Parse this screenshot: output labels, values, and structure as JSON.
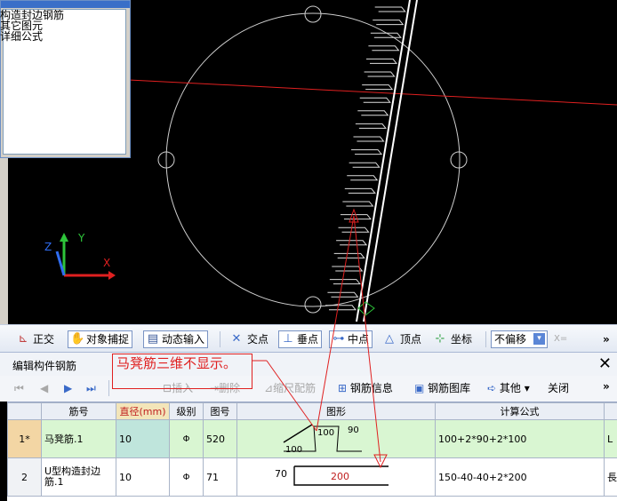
{
  "popup": {
    "lines": [
      "构造封边钢筋",
      "其它图元",
      "详细公式"
    ]
  },
  "snapbar": {
    "ortho": "正交",
    "object_snap": "对象捕捉",
    "dynamic_input": "动态输入",
    "intersection": "交点",
    "perpendicular": "垂点",
    "midpoint": "中点",
    "vertex": "顶点",
    "coordinate": "坐标",
    "offset_value": "不偏移",
    "x_label": "X=",
    "more": "»"
  },
  "panel": {
    "title": "编辑构件钢筋",
    "annotation": "马凳筋三维不显示。",
    "toolbar": {
      "insert": "插入",
      "delete": "删除",
      "scale_rebar": "缩尺配筋",
      "rebar_info": "钢筋信息",
      "rebar_library": "钢筋图库",
      "other": "其他",
      "close": "关闭",
      "more": "»"
    },
    "columns": [
      "筋号",
      "直径(mm)",
      "级别",
      "图号",
      "图形",
      "计算公式"
    ],
    "rows": [
      {
        "no": "1*",
        "name": "马凳筋.1",
        "diameter": "10",
        "grade": "Φ",
        "fig": "520",
        "shape_a": "100",
        "shape_b": "90",
        "shape_c": "100",
        "formula": "100+2*90+2*100",
        "extra": "L"
      },
      {
        "no": "2",
        "name": "U型构造封边筋.1",
        "diameter": "10",
        "grade": "Φ",
        "fig": "71",
        "shape_a": "70",
        "shape_b": "200",
        "formula": "150-40-40+2*200",
        "extra": "長"
      }
    ]
  },
  "colors": {
    "annotation": "#e02020",
    "canvas": "#000000",
    "highlight": "#d9f6d2"
  }
}
